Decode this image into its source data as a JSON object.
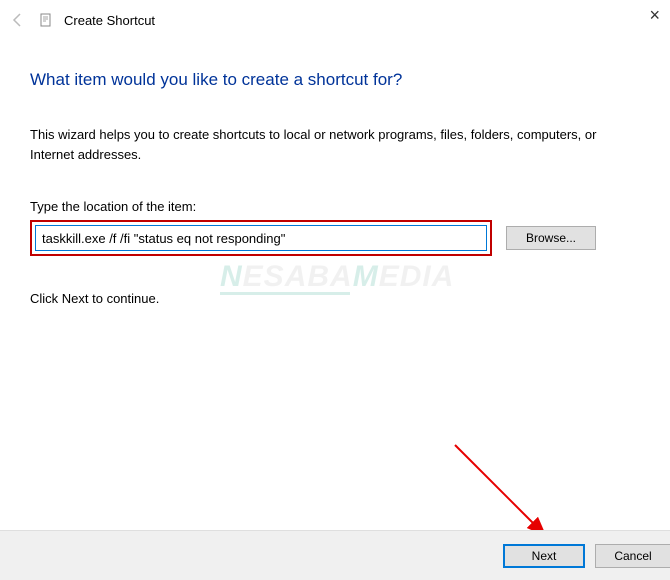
{
  "titlebar": {
    "title": "Create Shortcut"
  },
  "content": {
    "heading": "What item would you like to create a shortcut for?",
    "description": "This wizard helps you to create shortcuts to local or network programs, files, folders, computers, or Internet addresses.",
    "field_label": "Type the location of the item:",
    "location_value": "taskkill.exe /f /fi \"status eq not responding\"",
    "browse_label": "Browse...",
    "continue_text": "Click Next to continue."
  },
  "footer": {
    "next_label": "Next",
    "cancel_label": "Cancel"
  },
  "watermark": {
    "text": "NESABAMEDIA"
  }
}
